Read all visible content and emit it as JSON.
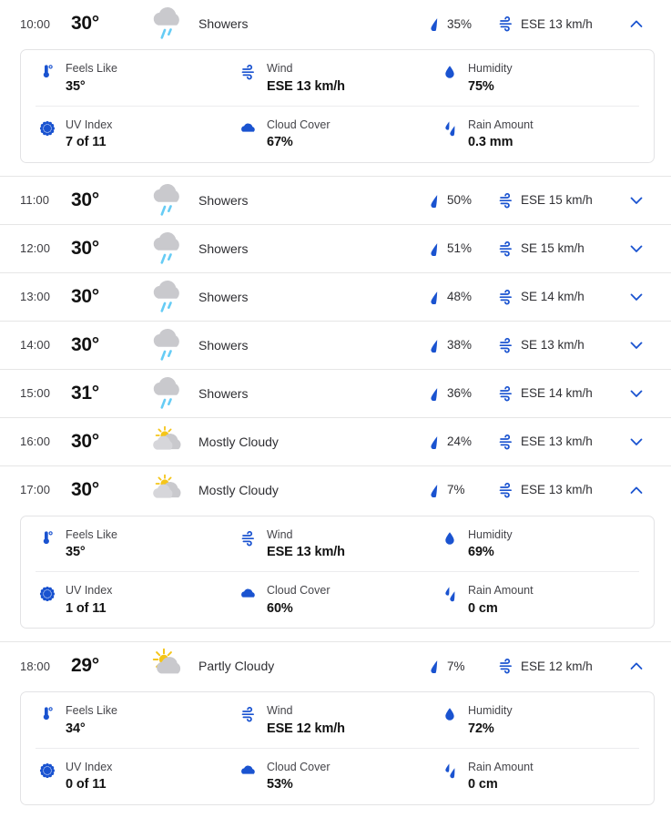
{
  "accent_blue": "#1a53d0",
  "cloud_gray": "#c9c9cd",
  "rain_blue": "#66ccf5",
  "sun_yellow": "#f5c518",
  "labels": {
    "feels_like": "Feels Like",
    "wind": "Wind",
    "humidity": "Humidity",
    "uv_index": "UV Index",
    "cloud_cover": "Cloud Cover",
    "rain_amount": "Rain Amount"
  },
  "icons": {
    "condition_showers": "showers-icon",
    "condition_mostly_cloudy": "mostly-cloudy-icon",
    "condition_partly_cloudy": "partly-cloudy-icon",
    "precip": "raindrop-icon",
    "wind": "wind-icon",
    "expand": "chevron-down-icon",
    "collapse": "chevron-up-icon",
    "feels_like": "thermometer-icon",
    "humidity": "water-drop-icon",
    "uv_index": "sun-icon",
    "cloud_cover": "cloud-icon",
    "rain_amount": "rain-drops-icon"
  },
  "hours": [
    {
      "time": "10:00",
      "temp": "30°",
      "condition": "Showers",
      "condition_icon": "showers",
      "precip": "35%",
      "wind": "ESE 13 km/h",
      "expanded": true,
      "details": {
        "feels_like": "35°",
        "wind": "ESE 13 km/h",
        "humidity": "75%",
        "uv_index": "7 of 11",
        "cloud_cover": "67%",
        "rain_amount": "0.3 mm"
      }
    },
    {
      "time": "11:00",
      "temp": "30°",
      "condition": "Showers",
      "condition_icon": "showers",
      "precip": "50%",
      "wind": "ESE 15 km/h",
      "expanded": false
    },
    {
      "time": "12:00",
      "temp": "30°",
      "condition": "Showers",
      "condition_icon": "showers",
      "precip": "51%",
      "wind": "SE 15 km/h",
      "expanded": false
    },
    {
      "time": "13:00",
      "temp": "30°",
      "condition": "Showers",
      "condition_icon": "showers",
      "precip": "48%",
      "wind": "SE 14 km/h",
      "expanded": false
    },
    {
      "time": "14:00",
      "temp": "30°",
      "condition": "Showers",
      "condition_icon": "showers",
      "precip": "38%",
      "wind": "SE 13 km/h",
      "expanded": false
    },
    {
      "time": "15:00",
      "temp": "31°",
      "condition": "Showers",
      "condition_icon": "showers",
      "precip": "36%",
      "wind": "ESE 14 km/h",
      "expanded": false
    },
    {
      "time": "16:00",
      "temp": "30°",
      "condition": "Mostly Cloudy",
      "condition_icon": "mostly_cloudy",
      "precip": "24%",
      "wind": "ESE 13 km/h",
      "expanded": false
    },
    {
      "time": "17:00",
      "temp": "30°",
      "condition": "Mostly Cloudy",
      "condition_icon": "mostly_cloudy",
      "precip": "7%",
      "wind": "ESE 13 km/h",
      "expanded": true,
      "details": {
        "feels_like": "35°",
        "wind": "ESE 13 km/h",
        "humidity": "69%",
        "uv_index": "1 of 11",
        "cloud_cover": "60%",
        "rain_amount": "0 cm"
      }
    },
    {
      "time": "18:00",
      "temp": "29°",
      "condition": "Partly Cloudy",
      "condition_icon": "partly_cloudy",
      "precip": "7%",
      "wind": "ESE 12 km/h",
      "expanded": true,
      "details": {
        "feels_like": "34°",
        "wind": "ESE 12 km/h",
        "humidity": "72%",
        "uv_index": "0 of 11",
        "cloud_cover": "53%",
        "rain_amount": "0 cm"
      }
    }
  ]
}
